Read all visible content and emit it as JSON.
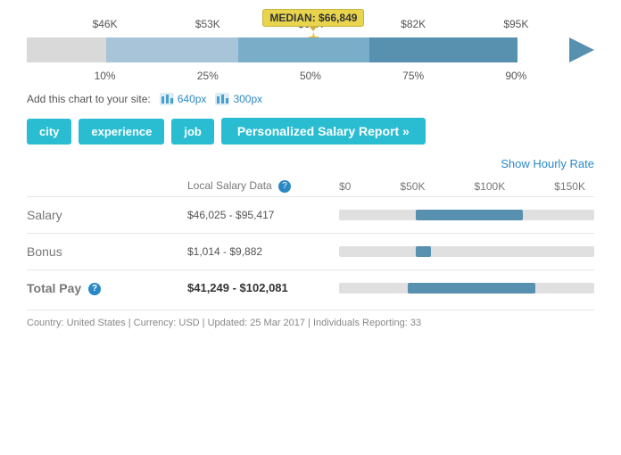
{
  "salary_labels": [
    "$46K",
    "$53K",
    "$67K",
    "$82K",
    "$95K"
  ],
  "pct_labels": [
    "10%",
    "25%",
    "50%",
    "75%",
    "90%"
  ],
  "median": {
    "label": "MEDIAN: $66,849",
    "star": "★"
  },
  "add_chart": {
    "prefix": "Add this chart to your site:",
    "link1": "640px",
    "link2": "300px"
  },
  "buttons": {
    "city": "city",
    "experience": "experience",
    "job": "job",
    "personalized": "Personalized Salary Report »"
  },
  "show_hourly": "Show Hourly Rate",
  "table": {
    "col_local": "Local Salary Data",
    "col_bar_labels": [
      "$0",
      "$50K",
      "$100K",
      "$150K"
    ],
    "rows": [
      {
        "name": "Salary",
        "bold": false,
        "range": "$46,025 - $95,417",
        "range_bold": false,
        "bar_start_pct": 30,
        "bar_width_pct": 42
      },
      {
        "name": "Bonus",
        "bold": false,
        "range": "$1,014 - $9,882",
        "range_bold": false,
        "bar_start_pct": 30,
        "bar_width_pct": 6
      },
      {
        "name": "Total Pay",
        "bold": true,
        "range": "$41,249 - $102,081",
        "range_bold": true,
        "bar_start_pct": 27,
        "bar_width_pct": 50
      }
    ]
  },
  "footer": "Country: United States | Currency: USD | Updated: 25 Mar 2017 | Individuals Reporting: 33",
  "colors": {
    "accent": "#2a89c5",
    "teal": "#2abdd2",
    "bar_blue": "#5890b0",
    "median_yellow": "#e8d44d"
  }
}
